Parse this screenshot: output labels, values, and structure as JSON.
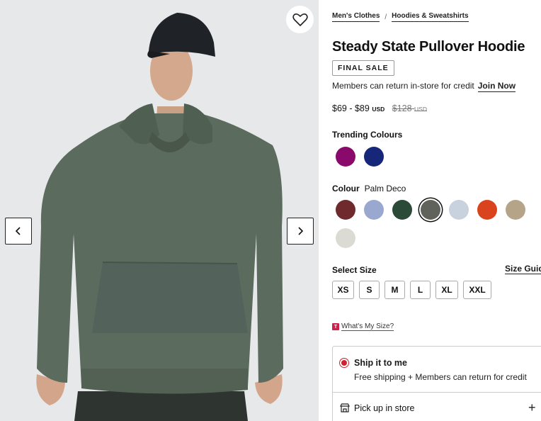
{
  "breadcrumb": {
    "items": [
      "Men's Clothes",
      "Hoodies & Sweatshirts"
    ],
    "separator": "/"
  },
  "product": {
    "title": "Steady State Pullover Hoodie",
    "badge": "FINAL SALE",
    "members_text": "Members can return in-store for credit",
    "join_label": "Join Now",
    "price_range": "$69 - $89",
    "currency": "USD",
    "original_price": "$128",
    "original_currency": "USD"
  },
  "trending": {
    "label": "Trending Colours",
    "swatches": [
      {
        "color": "#8a0a6c"
      },
      {
        "color": "#16277a"
      }
    ]
  },
  "colour": {
    "label": "Colour",
    "selected_name": "Palm Deco",
    "swatches": [
      {
        "color": "#6e2a2d"
      },
      {
        "color": "#9aa8d0"
      },
      {
        "color": "#2c4a38"
      },
      {
        "color": "#5f635c",
        "selected": true
      },
      {
        "color": "#c7d2de"
      },
      {
        "color": "#d9441e"
      },
      {
        "color": "#b5a488"
      },
      {
        "color": "#dcdbd3"
      }
    ]
  },
  "size": {
    "label": "Select Size",
    "guide_label": "Size Guid",
    "options": [
      "XS",
      "S",
      "M",
      "L",
      "XL",
      "XXL"
    ],
    "whats_my_size_tag": "T",
    "whats_my_size": "What's My Size?"
  },
  "fulfillment": {
    "ship_title": "Ship it to me",
    "ship_sub": "Free shipping + Members can return for credit",
    "pickup_title": "Pick up in store",
    "expand_symbol": "+"
  },
  "icons": {
    "wishlist": "heart-icon",
    "prev": "chevron-left-icon",
    "next": "chevron-right-icon",
    "store": "store-icon"
  },
  "colors": {
    "hoodie": "#5b6b5e",
    "accent_red": "#d01f2e"
  }
}
